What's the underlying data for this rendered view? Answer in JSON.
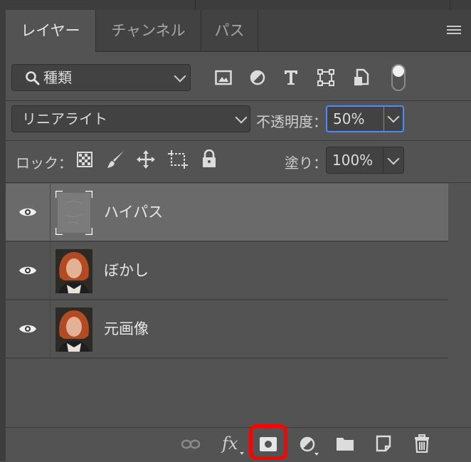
{
  "tabs": [
    {
      "label": "レイヤー",
      "active": true
    },
    {
      "label": "チャンネル",
      "active": false
    },
    {
      "label": "パス",
      "active": false
    }
  ],
  "filter": {
    "label": "種類",
    "icon": "search-icon"
  },
  "filter_icons": [
    "image-icon",
    "adjustment-icon",
    "type-icon",
    "shape-icon",
    "smart-object-icon",
    "filter-toggle-icon"
  ],
  "blend": {
    "mode": "リニアライト",
    "opacity_label": "不透明度：",
    "opacity_value": "50%"
  },
  "lock": {
    "label": "ロック：",
    "fill_label": "塗り：",
    "fill_value": "100%"
  },
  "layers": [
    {
      "name": "ハイパス",
      "selected": true,
      "visible": true,
      "thumb": "highpass"
    },
    {
      "name": "ぼかし",
      "selected": false,
      "visible": true,
      "thumb": "portrait"
    },
    {
      "name": "元画像",
      "selected": false,
      "visible": true,
      "thumb": "portrait"
    }
  ],
  "bottom_icons": [
    "link-icon",
    "fx-icon",
    "add-mask-icon",
    "adjustment-layer-icon",
    "folder-icon",
    "new-layer-icon",
    "trash-icon"
  ],
  "highlighted_button": "add-mask-button",
  "colors": {
    "panel": "#535353",
    "selected_row": "#6a6a6a",
    "focus_border": "#4a8cff",
    "highlight": "#ff0000"
  }
}
